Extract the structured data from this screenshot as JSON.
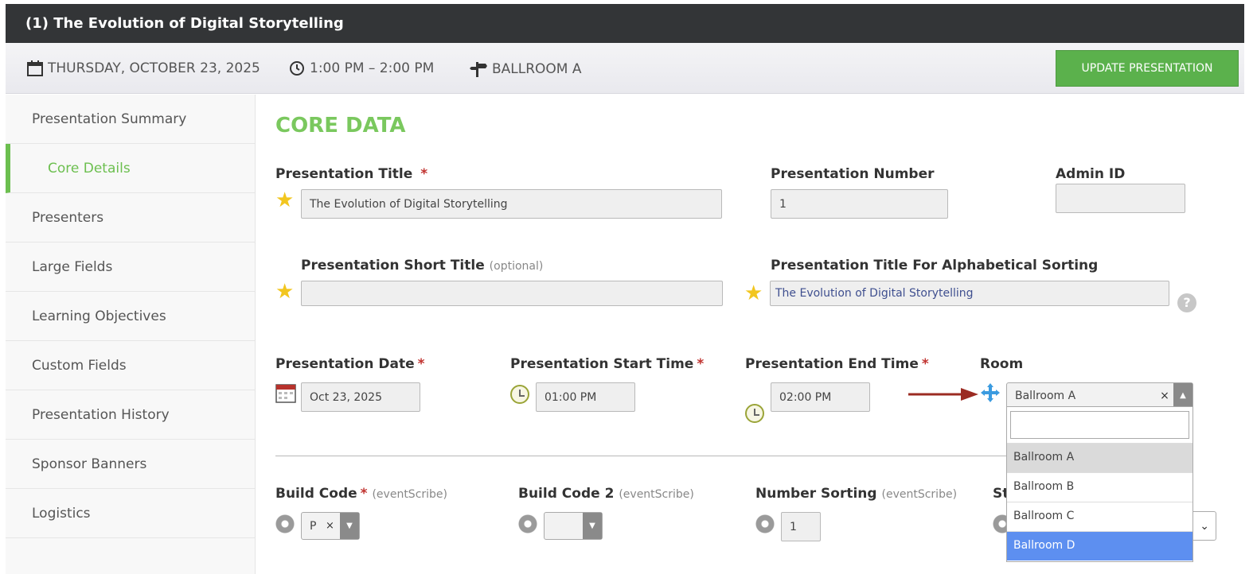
{
  "title": "(1) The Evolution of Digital Storytelling",
  "info": {
    "date": "THURSDAY, OCTOBER 23, 2025",
    "time": "1:00 PM – 2:00 PM",
    "room": "BALLROOM A",
    "update_label": "UPDATE PRESENTATION"
  },
  "sidebar": {
    "items": [
      {
        "label": "Presentation Summary"
      },
      {
        "label": "Core Details"
      },
      {
        "label": "Presenters"
      },
      {
        "label": "Large Fields"
      },
      {
        "label": "Learning Objectives"
      },
      {
        "label": "Custom Fields"
      },
      {
        "label": "Presentation History"
      },
      {
        "label": "Sponsor Banners"
      },
      {
        "label": "Logistics"
      }
    ],
    "active": "Core Details"
  },
  "core": {
    "heading": "CORE DATA",
    "title_label": "Presentation Title",
    "title_value": "The Evolution of Digital Storytelling",
    "number_label": "Presentation Number",
    "number_value": "1",
    "admin_label": "Admin ID",
    "admin_value": "",
    "short_label": "Presentation Short Title",
    "short_optional": "(optional)",
    "short_value": "",
    "sort_label": "Presentation Title For Alphabetical Sorting",
    "sort_value": "The Evolution of Digital Storytelling",
    "date_label": "Presentation Date",
    "date_value": "Oct 23, 2025",
    "start_label": "Presentation Start Time",
    "start_value": "01:00 PM",
    "end_label": "Presentation End Time",
    "end_value": "02:00 PM",
    "room_label": "Room",
    "room_value": "Ballroom A",
    "room_options": [
      "Ballroom A",
      "Ballroom B",
      "Ballroom C",
      "Ballroom D"
    ],
    "room_highlighted": "Ballroom A",
    "room_hover": "Ballroom D",
    "build_label": "Build Code",
    "build_note": "(eventScribe)",
    "build_value": "P",
    "build2_label": "Build Code 2",
    "build2_note": "(eventScribe)",
    "numsort_label": "Number Sorting",
    "numsort_note": "(eventScribe)",
    "numsort_value": "1",
    "partial_label": "St",
    "required_mark": "*",
    "clear_mark": "×",
    "help_mark": "?"
  },
  "colors": {
    "accent": "#6cbf4f",
    "button": "#5bb14c",
    "arrow": "#9b2b22",
    "selected": "#5d8ff0"
  }
}
